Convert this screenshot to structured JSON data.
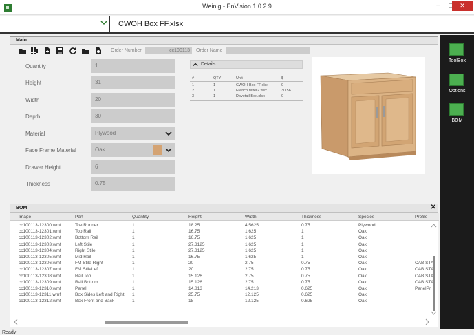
{
  "window": {
    "title": "Weinig - EnVision 1.0.2.9",
    "min": "–",
    "max": "□",
    "close": "✕"
  },
  "file": {
    "name": "CWOH Box FF.xlsx"
  },
  "sidebar": {
    "items": [
      {
        "label": "ToolBox",
        "icon": "toolbox-icon"
      },
      {
        "label": "Options",
        "icon": "options-icon"
      },
      {
        "label": "BOM",
        "icon": "bom-icon"
      }
    ]
  },
  "main": {
    "header": "Main",
    "order_number_label": "Order Number",
    "order_number_value": "cc100113",
    "order_name_label": "Order Name",
    "order_name_value": "",
    "fields": [
      {
        "label": "Quantity",
        "value": "1"
      },
      {
        "label": "Height",
        "value": "31"
      },
      {
        "label": "Width",
        "value": "20"
      },
      {
        "label": "Depth",
        "value": "30"
      },
      {
        "label": "Material",
        "value": "Plywood"
      },
      {
        "label": "Face Frame Material",
        "value": "Oak"
      },
      {
        "label": "Drawer Height",
        "value": "6"
      },
      {
        "label": "Thickness",
        "value": "0.75"
      }
    ],
    "details": {
      "title": "Details",
      "columns": [
        "#",
        "QTY",
        "Unit",
        "$"
      ],
      "rows": [
        [
          "1",
          "1",
          "CWOH Box FF.xlsx",
          "0"
        ],
        [
          "2",
          "1",
          "French Miter2.xlsx",
          "30.56"
        ],
        [
          "3",
          "1",
          "Dovetail Box.xlsx",
          "0"
        ]
      ]
    }
  },
  "bom": {
    "header": "BOM",
    "close": "✕",
    "columns": [
      "Image",
      "Part",
      "Quantity",
      "Height",
      "Width",
      "Thickness",
      "Species",
      "Profile"
    ],
    "rows": [
      [
        "cc100113-12300.wmf",
        "Toe Runner",
        "1",
        "18.25",
        "4.5625",
        "0.75",
        "Plywood",
        ""
      ],
      [
        "cc100113-12301.wmf",
        "Top Rail",
        "1",
        "16.75",
        "1.625",
        "1",
        "Oak",
        ""
      ],
      [
        "cc100113-12302.wmf",
        "Bottom Rail",
        "1",
        "16.75",
        "1.625",
        "1",
        "Oak",
        ""
      ],
      [
        "cc100113-12303.wmf",
        "Left Stile",
        "1",
        "27.3125",
        "1.625",
        "1",
        "Oak",
        ""
      ],
      [
        "cc100113-12304.wmf",
        "Right Stile",
        "1",
        "27.3125",
        "1.625",
        "1",
        "Oak",
        ""
      ],
      [
        "cc100113-12305.wmf",
        "Mid Rail",
        "1",
        "16.75",
        "1.625",
        "1",
        "Oak",
        ""
      ],
      [
        "cc100113-12306.wmf",
        "FM Stile Right",
        "1",
        "20",
        "2.75",
        "0.75",
        "Oak",
        "CAB STA"
      ],
      [
        "cc100113-12307.wmf",
        "FM StileLeft",
        "1",
        "20",
        "2.75",
        "0.75",
        "Oak",
        "CAB STA"
      ],
      [
        "cc100113-12308.wmf",
        "Rail Top",
        "1",
        "15.126",
        "2.75",
        "0.75",
        "Oak",
        "CAB STA"
      ],
      [
        "cc100113-12309.wmf",
        "Rail Bottom",
        "1",
        "15.126",
        "2.75",
        "0.75",
        "Oak",
        "CAB STA"
      ],
      [
        "cc100113-12310.wmf",
        "Panel",
        "1",
        "14.813",
        "14.213",
        "0.625",
        "Oak",
        "PanelPr"
      ],
      [
        "cc100113-12311.wmf",
        "Box Sides Left and Right",
        "1",
        "25.75",
        "12.125",
        "0.625",
        "Oak",
        ""
      ],
      [
        "cc100113-12312.wmf",
        "Box Front and Back",
        "1",
        "18",
        "12.125",
        "0.625",
        "Oak",
        ""
      ]
    ]
  },
  "status": "Ready",
  "colors": {
    "accent": "#4caf50",
    "sidebar": "#1b1b1b",
    "close": "#c9302c"
  }
}
